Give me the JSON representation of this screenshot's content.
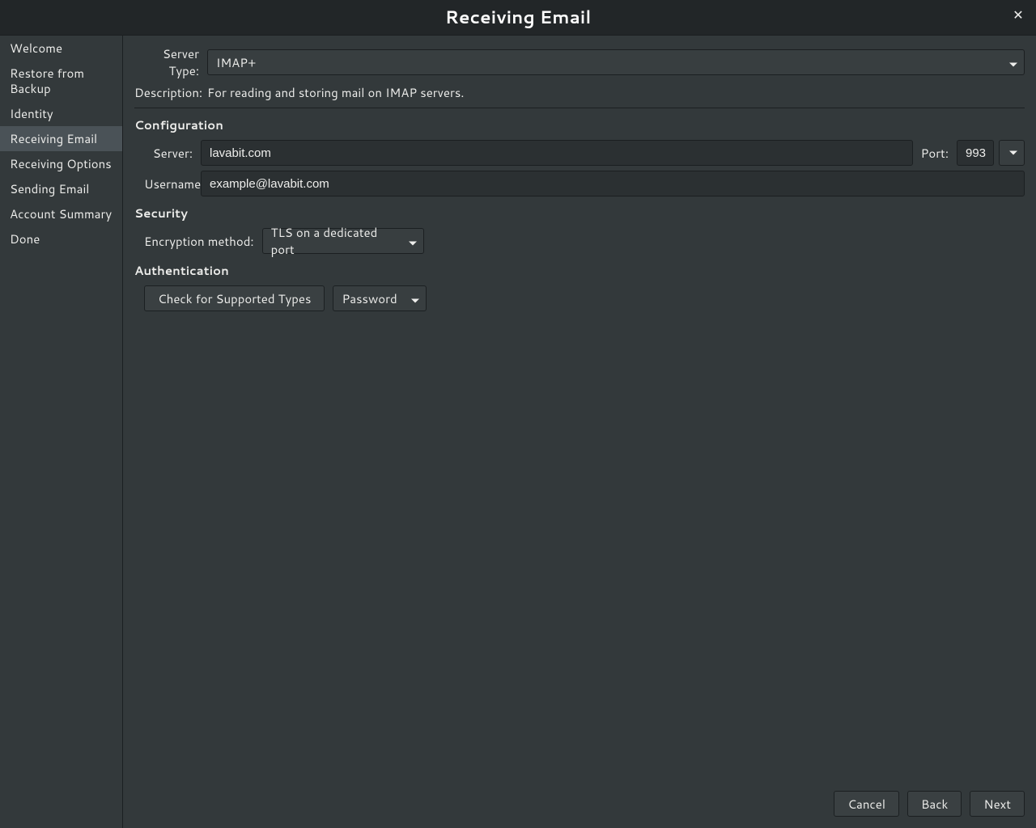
{
  "window": {
    "title": "Receiving Email"
  },
  "sidebar": {
    "items": [
      {
        "label": "Welcome"
      },
      {
        "label": "Restore from Backup"
      },
      {
        "label": "Identity"
      },
      {
        "label": "Receiving Email"
      },
      {
        "label": "Receiving Options"
      },
      {
        "label": "Sending Email"
      },
      {
        "label": "Account Summary"
      },
      {
        "label": "Done"
      }
    ],
    "active_index": 3
  },
  "form": {
    "server_type_label": "Server Type:",
    "server_type_value": "IMAP+",
    "description_label": "Description:",
    "description_value": "For reading and storing mail on IMAP servers.",
    "configuration_header": "Configuration",
    "server_label": "Server:",
    "server_value": "lavabit.com",
    "port_label": "Port:",
    "port_value": "993",
    "username_label": "Username:",
    "username_value": "example@lavabit.com",
    "security_header": "Security",
    "encryption_label": "Encryption method:",
    "encryption_value": "TLS on a dedicated port",
    "authentication_header": "Authentication",
    "check_types_label": "Check for Supported Types",
    "auth_method_value": "Password"
  },
  "footer": {
    "cancel": "Cancel",
    "back": "Back",
    "next": "Next"
  }
}
